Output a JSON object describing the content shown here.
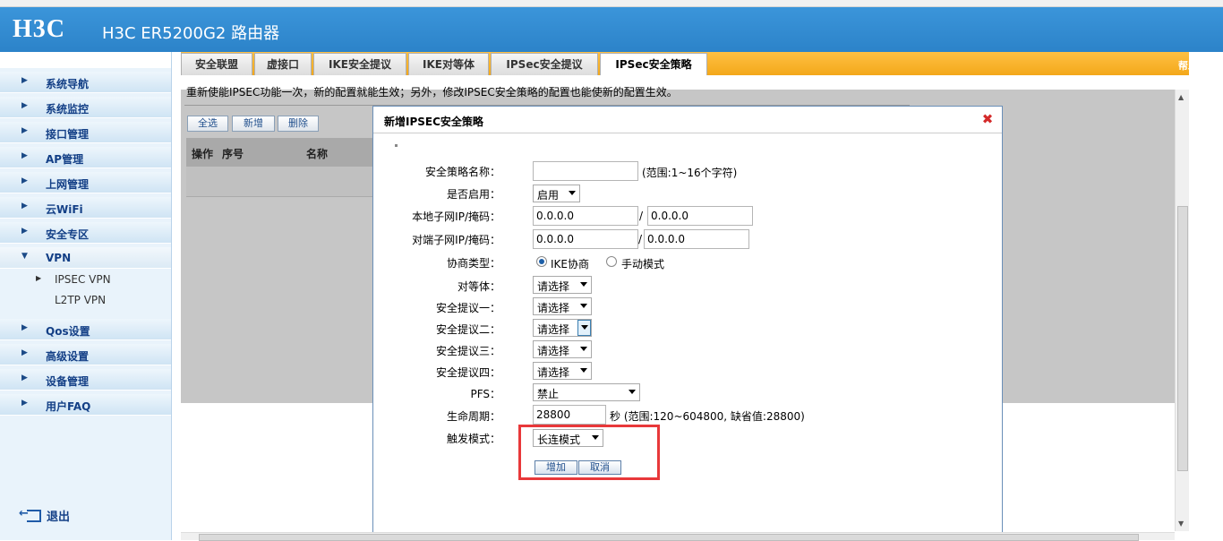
{
  "header": {
    "logo": "H3C",
    "title": "H3C ER5200G2 路由器"
  },
  "sidebar": {
    "items": [
      {
        "label": "系统导航"
      },
      {
        "label": "系统监控"
      },
      {
        "label": "接口管理"
      },
      {
        "label": "AP管理"
      },
      {
        "label": "上网管理"
      },
      {
        "label": "云WiFi"
      },
      {
        "label": "安全专区"
      },
      {
        "label": "VPN",
        "expanded": true
      },
      {
        "label": "Qos设置"
      },
      {
        "label": "高级设置"
      },
      {
        "label": "设备管理"
      },
      {
        "label": "用户FAQ"
      }
    ],
    "vpn_subitems": [
      {
        "label": "IPSEC VPN",
        "selected": true
      },
      {
        "label": "L2TP VPN"
      }
    ],
    "logout": "退出"
  },
  "tabs": {
    "items": [
      "安全联盟",
      "虚接口",
      "IKE安全提议",
      "IKE对等体",
      "IPSec安全提议",
      "IPSec安全策略"
    ],
    "active": "IPSec安全策略",
    "help": "帮助"
  },
  "content": {
    "notice": "重新使能IPSEC功能一次，新的配置就能生效；另外，修改IPSEC安全策略的配置也能使新的配置生效。",
    "buttons": {
      "select_all": "全选",
      "add": "新增",
      "delete": "删除"
    },
    "grid_headers": [
      "操作",
      "序号",
      "名称"
    ]
  },
  "dialog": {
    "title": "新增IPSEC安全策略",
    "fields": {
      "policy_name": {
        "label": "安全策略名称：",
        "value": "",
        "hint": "(范围:1~16个字符)"
      },
      "enabled": {
        "label": "是否启用：",
        "value": "启用"
      },
      "local_subnet": {
        "label": "本地子网IP/掩码：",
        "ip": "0.0.0.0",
        "sep": "/",
        "mask": "0.0.0.0"
      },
      "remote_subnet": {
        "label": "对端子网IP/掩码：",
        "ip": "0.0.0.0",
        "sep": "/",
        "mask": "0.0.0.0"
      },
      "negotiation": {
        "label": "协商类型：",
        "option_ike": "IKE协商",
        "option_manual": "手动模式",
        "selected": "IKE协商"
      },
      "peer": {
        "label": "对等体：",
        "value": "请选择"
      },
      "proposal1": {
        "label": "安全提议一：",
        "value": "请选择"
      },
      "proposal2": {
        "label": "安全提议二：",
        "value": "请选择"
      },
      "proposal3": {
        "label": "安全提议三：",
        "value": "请选择"
      },
      "proposal4": {
        "label": "安全提议四：",
        "value": "请选择"
      },
      "pfs": {
        "label": "PFS：",
        "value": "禁止"
      },
      "lifetime": {
        "label": "生命周期：",
        "value": "28800",
        "hint": "秒 (范围:120~604800, 缺省值:28800)"
      },
      "trigger": {
        "label": "触发模式：",
        "value": "长连模式"
      }
    },
    "buttons": {
      "add": "增加",
      "cancel": "取消"
    }
  },
  "colors": {
    "header": "#2f8ad2",
    "tabbar": "#f3a81a",
    "highlight": "#e8383a"
  }
}
